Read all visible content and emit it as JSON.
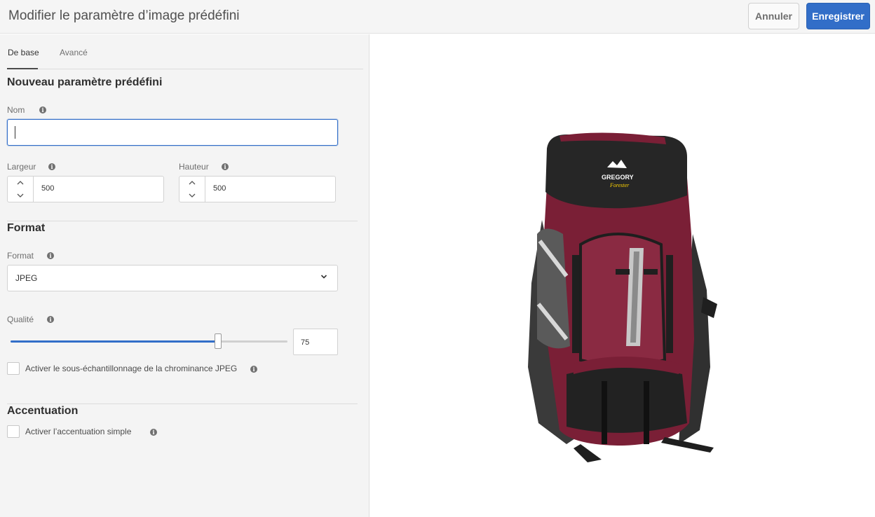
{
  "header": {
    "title": "Modifier le paramètre d’image prédéfini",
    "cancel_label": "Annuler",
    "save_label": "Enregistrer"
  },
  "tabs": [
    {
      "label": "De base",
      "active": true
    },
    {
      "label": "Avancé",
      "active": false
    }
  ],
  "form": {
    "section_title": "Nouveau paramètre prédéfini",
    "name": {
      "label": "Nom",
      "value": ""
    },
    "width": {
      "label": "Largeur",
      "value": "500"
    },
    "height": {
      "label": "Hauteur",
      "value": "500"
    },
    "format_section": "Format",
    "format": {
      "label": "Format",
      "value": "JPEG"
    },
    "quality": {
      "label": "Qualité",
      "value": "75",
      "percent": 75
    },
    "chroma_checkbox": {
      "label": "Activer le sous-échantillonnage de la chrominance JPEG",
      "checked": false
    },
    "sharpen_section": "Accentuation",
    "sharpen_checkbox": {
      "label": "Activer l’accentuation simple",
      "checked": false
    }
  },
  "preview": {
    "brand_text": "GREGORY",
    "model_text": "Forester"
  },
  "colors": {
    "accent": "#326ec8",
    "pack_maroon": "#7a1f36",
    "pack_black": "#262626"
  },
  "icons": {
    "info": "info-icon",
    "up": "chevron-up-icon",
    "down": "chevron-down-icon"
  }
}
